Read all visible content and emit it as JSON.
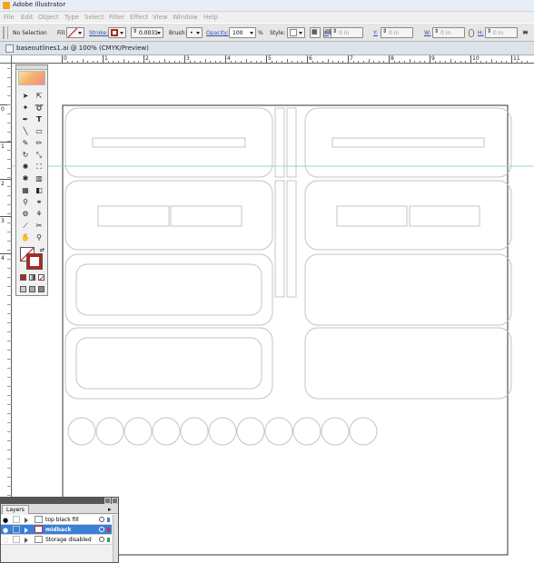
{
  "app": {
    "title": "Adobe Illustrator",
    "brand_color": "#f7a21b"
  },
  "menu": [
    "File",
    "Edit",
    "Object",
    "Type",
    "Select",
    "Filter",
    "Effect",
    "View",
    "Window",
    "Help"
  ],
  "control_bar": {
    "selection": "No Selection",
    "fill_label": "Fill:",
    "stroke_label": "Stroke:",
    "stroke_weight": "0.0031",
    "brush_label": "Brush:",
    "brush_value": "•",
    "opacity_label": "Opacity:",
    "opacity_value": "100",
    "opacity_unit": "%",
    "style_label": "Style:",
    "x_label": "X:",
    "x_value": "0 in",
    "y_label": "Y:",
    "y_value": "0 in",
    "w_label": "W:",
    "w_value": "0 in",
    "h_label": "H:",
    "h_value": "0 in",
    "stroke_color": "#b0281e"
  },
  "document": {
    "tab_title": "baseoutlines1.ai @ 100% (CMYK/Preview)"
  },
  "rulers": {
    "horizontal_ticks": [
      "0",
      "1",
      "2",
      "3",
      "4",
      "5",
      "6",
      "7",
      "8",
      "9",
      "10",
      "11"
    ],
    "vertical_ticks": [
      "0",
      "1",
      "2",
      "3",
      "4"
    ]
  },
  "toolbox": {
    "tools": [
      "selection-tool",
      "direct-selection-tool",
      "magic-wand-tool",
      "lasso-tool",
      "pen-tool",
      "type-tool",
      "line-segment-tool",
      "rectangle-tool",
      "paintbrush-tool",
      "pencil-tool",
      "rotate-tool",
      "scale-tool",
      "warp-tool",
      "free-transform-tool",
      "symbol-sprayer-tool",
      "column-graph-tool",
      "mesh-tool",
      "gradient-tool",
      "eyedropper-tool",
      "blend-tool",
      "live-paint-tool",
      "live-paint-selection-tool",
      "slice-tool",
      "scissors-tool",
      "hand-tool",
      "zoom-tool"
    ],
    "fill_color": "#ffffff",
    "stroke_color": "#b0281e"
  },
  "layers_panel": {
    "tab": "Layers",
    "layers": [
      {
        "name": "top black fill",
        "selected": false,
        "color": "#4a7bd0"
      },
      {
        "name": "midback",
        "selected": true,
        "color": "#d03030"
      },
      {
        "name": "Storage disabled",
        "selected": false,
        "color": "#40a040"
      }
    ]
  },
  "guide_color": "#8fd8d8"
}
